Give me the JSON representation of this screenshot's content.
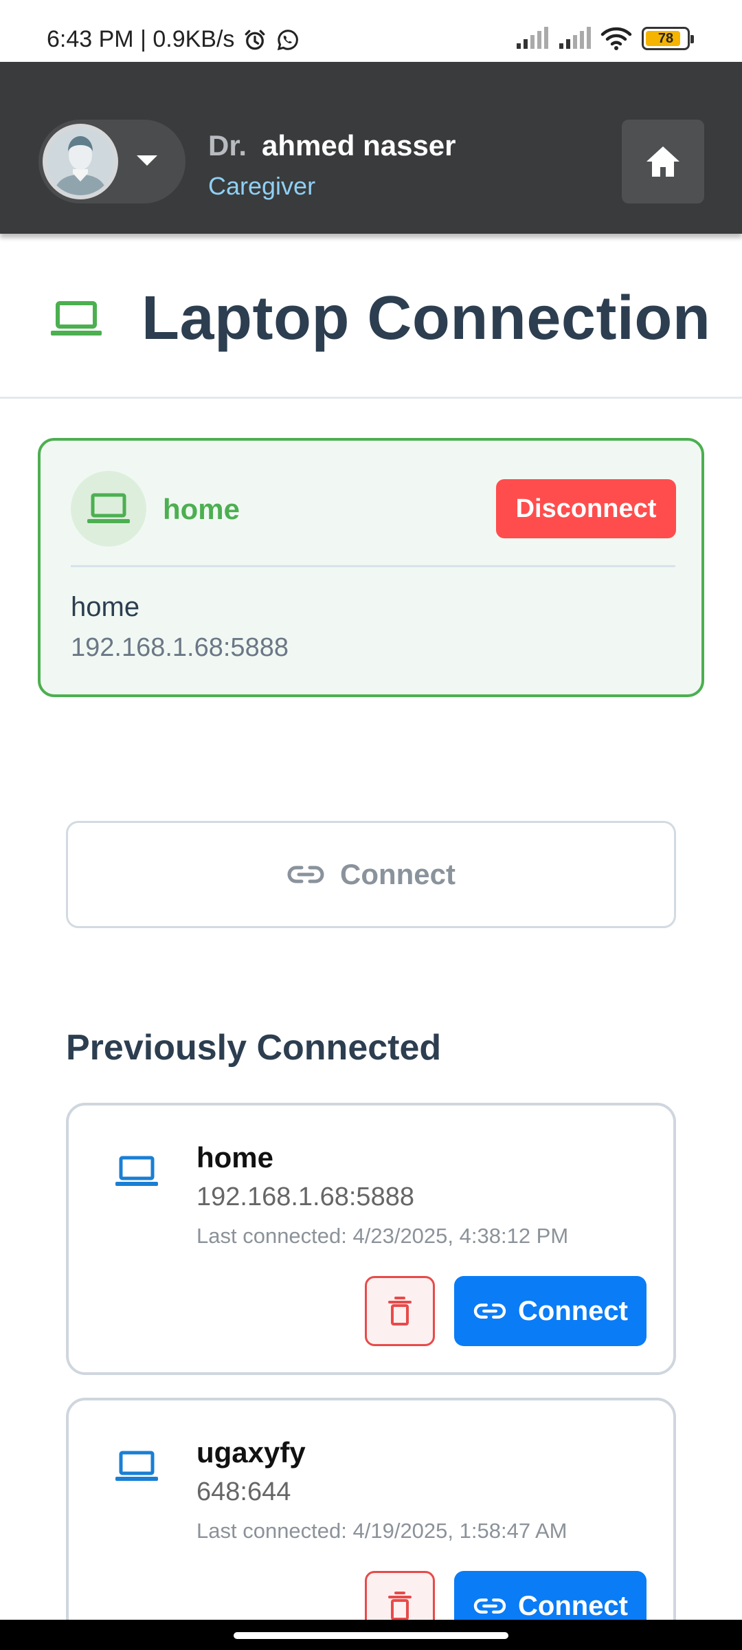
{
  "status_bar": {
    "time_info": "6:43 PM | 0.9KB/s",
    "alarm_icon": "alarm-icon",
    "whatsapp_icon": "whatsapp-icon",
    "battery_level": "78"
  },
  "header": {
    "prefix": "Dr.",
    "user_name": "ahmed nasser",
    "role": "Caregiver",
    "avatar_icon": "user-avatar-icon",
    "dropdown_icon": "caret-down-icon",
    "home_icon": "home-icon"
  },
  "page": {
    "title": "Laptop Connection",
    "title_icon": "laptop-icon"
  },
  "active_connection": {
    "name": "home",
    "disconnect_label": "Disconnect",
    "host": "home",
    "address": "192.168.1.68:5888"
  },
  "connect_button": {
    "label": "Connect",
    "icon": "link-icon"
  },
  "previous": {
    "heading": "Previously Connected",
    "items": [
      {
        "name": "home",
        "address": "192.168.1.68:5888",
        "last_connected": "Last connected: 4/23/2025, 4:38:12 PM",
        "connect_label": "Connect"
      },
      {
        "name": "ugaxyfy",
        "address": "648:644",
        "last_connected": "Last connected: 4/19/2025, 1:58:47 AM",
        "connect_label": "Connect"
      }
    ]
  },
  "colors": {
    "header_bg": "#3a3b3c",
    "success_green": "#4caf50",
    "danger_red": "#ff4d4d",
    "primary_blue": "#0a7cf6",
    "title_text": "#2c3e50",
    "role_text": "#8fd0f5"
  }
}
